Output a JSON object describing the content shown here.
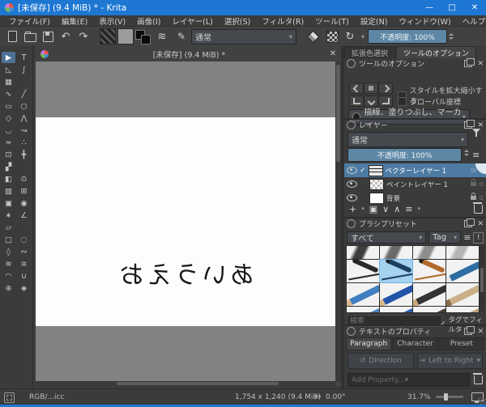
{
  "icons": {
    "dropdown": "▾",
    "close": "✕",
    "minimize": "—",
    "maximize": "□",
    "check": "✓",
    "alpha": "α",
    "add": "+",
    "up": "∧",
    "down": "∨",
    "menu": "≡",
    "exclaim": "!",
    "undo": "↶",
    "redo": "↷",
    "reload": "↻",
    "brush_settings": "≋",
    "brush_preset": "✎",
    "duplicate": "▣",
    "rotate_reset": "↔",
    "direction": "↺",
    "writing_icon": "⇥"
  },
  "window": {
    "title": "[未保存] (9.4 MiB) * - Krita",
    "accent_color": "#1d77d3"
  },
  "menubar": {
    "items": [
      "ファイル(F)",
      "編集(E)",
      "表示(V)",
      "画像(I)",
      "レイヤー(L)",
      "選択(S)",
      "フィルタ(R)",
      "ツール(T)",
      "設定(N)",
      "ウィンドウ(W)",
      "ヘルプ(H)"
    ]
  },
  "toolbar": {
    "blend_mode": "通常",
    "opacity_label": "不透明度: 100%"
  },
  "toolbox": {
    "tools": [
      {
        "name": "select-shapes",
        "glyph": "▶",
        "active": true
      },
      {
        "name": "text",
        "glyph": "T"
      },
      {
        "name": "edit-shapes",
        "glyph": "◺"
      },
      {
        "name": "calligraphy",
        "glyph": "∫"
      },
      {
        "name": "pattern-edit",
        "glyph": "▦"
      },
      {
        "name": "blank-1",
        "glyph": ""
      },
      {
        "name": "freehand-brush",
        "glyph": "∿"
      },
      {
        "name": "line",
        "glyph": "╱"
      },
      {
        "name": "rectangle",
        "glyph": "▭"
      },
      {
        "name": "ellipse",
        "glyph": "○"
      },
      {
        "name": "polygon",
        "glyph": "◇"
      },
      {
        "name": "polyline",
        "glyph": "⋀"
      },
      {
        "name": "bezier-curve",
        "glyph": "◡"
      },
      {
        "name": "freehand-path",
        "glyph": "↝"
      },
      {
        "name": "dynamic-brush",
        "glyph": "≈"
      },
      {
        "name": "multibrush",
        "glyph": "∴"
      },
      {
        "name": "transform",
        "glyph": "⊡"
      },
      {
        "name": "move",
        "glyph": "╋"
      },
      {
        "name": "crop",
        "glyph": "▞"
      },
      {
        "name": "blank-2",
        "glyph": ""
      },
      {
        "name": "gradient",
        "glyph": "◧"
      },
      {
        "name": "color-sampler",
        "glyph": "⊙"
      },
      {
        "name": "pattern",
        "glyph": "▨"
      },
      {
        "name": "smart-patch",
        "glyph": "⊞"
      },
      {
        "name": "fill",
        "glyph": "▣"
      },
      {
        "name": "enclose-fill",
        "glyph": "◉"
      },
      {
        "name": "assistants",
        "glyph": "∗"
      },
      {
        "name": "measure",
        "glyph": "∠"
      },
      {
        "name": "reference-images",
        "glyph": "▱"
      },
      {
        "name": "blank-3",
        "glyph": ""
      },
      {
        "name": "rect-select",
        "glyph": "□"
      },
      {
        "name": "ellipse-select",
        "glyph": "◌"
      },
      {
        "name": "polygon-select",
        "glyph": "◊"
      },
      {
        "name": "freehand-select",
        "glyph": "∾"
      },
      {
        "name": "contiguous-select",
        "glyph": "≋"
      },
      {
        "name": "similar-select",
        "glyph": "≅"
      },
      {
        "name": "bezier-select",
        "glyph": "◠"
      },
      {
        "name": "magnetic-select",
        "glyph": "∪"
      },
      {
        "name": "zoom",
        "glyph": "⊕"
      },
      {
        "name": "pan",
        "glyph": "◈"
      }
    ]
  },
  "document": {
    "tab_title": "[未保存] (9.4 MiB) *",
    "canvas_text": "あいうえお"
  },
  "docker_tabs": {
    "tab1": "拡張色選択",
    "tab2": "ツールのオプション"
  },
  "tool_options": {
    "title": "ツールのオプション",
    "checkbox1": "スタイルを拡大縮小する",
    "checkbox2": "グローバル座標",
    "combo": "描線、塗りつぶし、マーカー"
  },
  "layers": {
    "title": "レイヤー",
    "blend_mode": "通常",
    "opacity_label": "不透明度: 100%",
    "rows": [
      {
        "name": "ベクターレイヤー 1"
      },
      {
        "name": "ペイントレイヤー 1"
      },
      {
        "name": "背景"
      }
    ]
  },
  "brush_presets": {
    "title": "ブラシプリセット",
    "filter_all": "すべて",
    "tag_label": "Tag",
    "search_placeholder": "検索",
    "tag_filter_label": "タグでフィルタ",
    "cells": [
      {
        "name": "ink-stroke-1",
        "kind": "stroke",
        "c1": "#3c3c3c"
      },
      {
        "name": "ink-stroke-2",
        "kind": "stroke",
        "c1": "#6a6a6a"
      },
      {
        "name": "ink-stroke-3",
        "kind": "stroke",
        "c1": "#8d8d8d"
      },
      {
        "name": "ink-stroke-4",
        "kind": "stroke",
        "c1": "#b5b5b5"
      },
      {
        "name": "pen-black",
        "kind": "pen",
        "c1": "#2a2a2a"
      },
      {
        "name": "pen-blue-selected",
        "kind": "pen",
        "c1": "#1d3f63",
        "selected": true
      },
      {
        "name": "pen-orange",
        "kind": "pen",
        "c1": "#b06a2a"
      },
      {
        "name": "pencil-blue-tip",
        "kind": "pencil",
        "c1": "#2e6da4",
        "c2": "#e7e7e7"
      },
      {
        "name": "pencil-blue",
        "kind": "pencil",
        "c1": "#3f7fbf",
        "c2": "#d9b98c"
      },
      {
        "name": "pencil-navy",
        "kind": "pencil",
        "c1": "#2255aa",
        "c2": "#d9b98c"
      },
      {
        "name": "pencil-charcoal",
        "kind": "pencil",
        "c1": "#333333",
        "c2": "#caa87a"
      },
      {
        "name": "pencil-tan",
        "kind": "pencil",
        "c1": "#c9b089",
        "c2": "#8a6f4d"
      },
      {
        "name": "pencil-blue-2",
        "kind": "pencil",
        "c1": "#4a86c8",
        "c2": "#d9b98c"
      },
      {
        "name": "pencil-blue-3",
        "kind": "pencil",
        "c1": "#2a62b0",
        "c2": "#d9b98c"
      },
      {
        "name": "pencil-dark-2",
        "kind": "pencil",
        "c1": "#44403a",
        "c2": "#caa87a"
      },
      {
        "name": "pencil-tan-2",
        "kind": "pencil",
        "c1": "#bfa27c",
        "c2": "#7d6343"
      }
    ]
  },
  "text_properties": {
    "title": "テキストのプロパティ",
    "tabs": [
      "Paragraph",
      "Character",
      "Preset"
    ],
    "direction_label": "Direction",
    "writing_mode": "Left to Right",
    "add_property_placeholder": "Add Property..."
  },
  "statusbar": {
    "color_profile": "RGB/...icc",
    "dimensions": "1,754 x 1,240 (9.4 MiB)",
    "rotation": "0.00°",
    "zoom": "31.7%"
  }
}
